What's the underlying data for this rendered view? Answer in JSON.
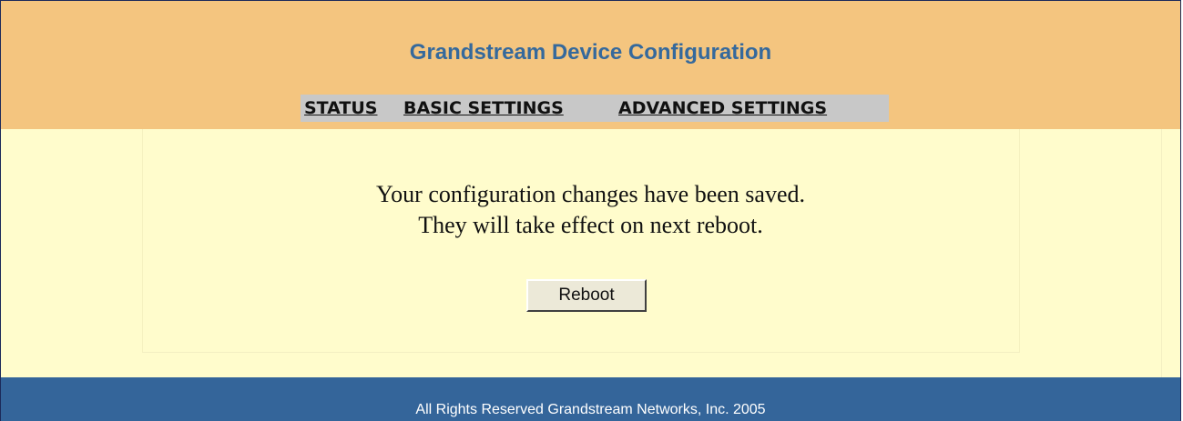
{
  "header": {
    "title": "Grandstream Device Configuration",
    "nav": {
      "status": "STATUS",
      "basic": "BASIC SETTINGS",
      "advanced": "ADVANCED SETTINGS"
    }
  },
  "main": {
    "message_line1": "Your configuration changes have been saved.",
    "message_line2": "They will take effect on next reboot.",
    "reboot_label": "Reboot"
  },
  "footer": {
    "text": "All Rights Reserved Grandstream Networks, Inc. 2005"
  },
  "colors": {
    "header_bg": "#f4c57f",
    "title": "#35699c",
    "content_bg": "#fffccc",
    "footer_bg": "#34659a",
    "nav_bg": "#c8c8c8"
  }
}
